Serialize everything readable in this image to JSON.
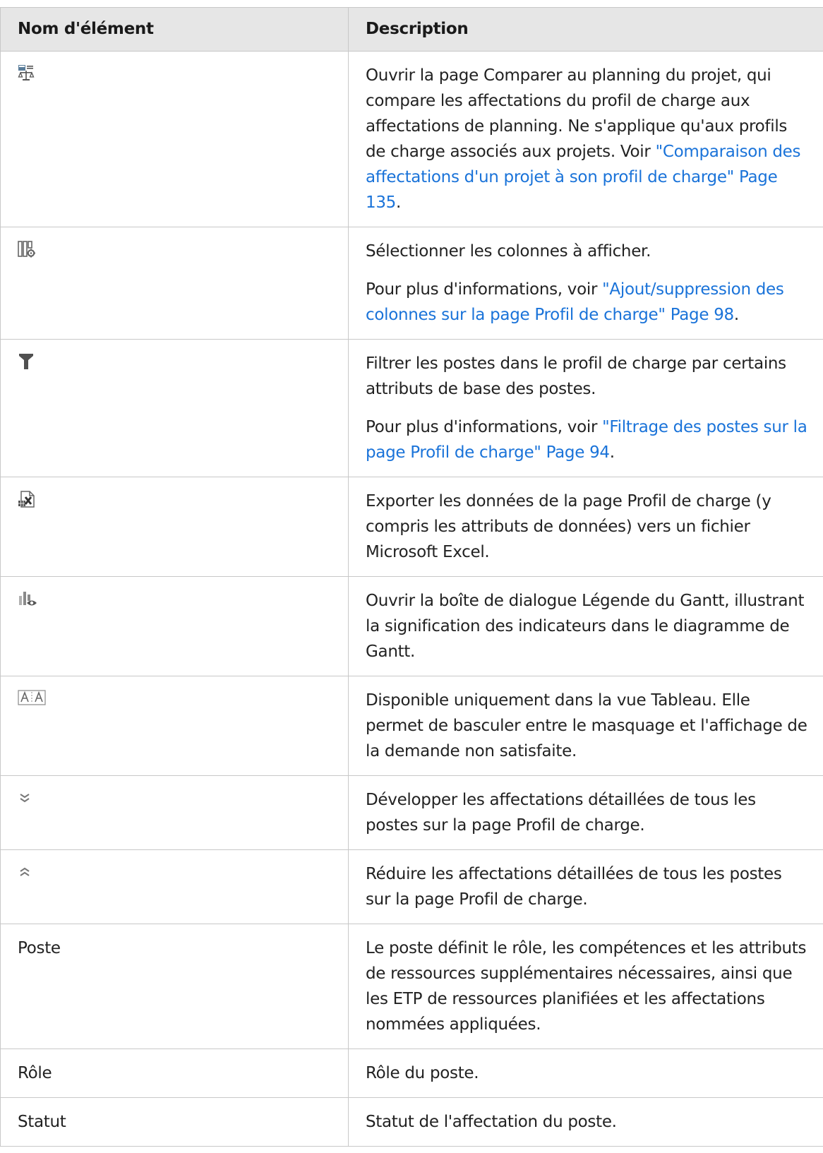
{
  "table": {
    "headers": {
      "name": "Nom d'élément",
      "description": "Description"
    },
    "rows": [
      {
        "icon": "compare-schedule-icon",
        "description": [
          {
            "text": "Ouvrir la page Comparer au planning du projet, qui compare les affectations du profil de charge aux affectations de planning. Ne s'applique qu'aux profils de charge associés aux projets. Voir ",
            "link": "\"Comparaison des affectations d'un projet à son profil de charge\" Page 135",
            "after": "."
          }
        ]
      },
      {
        "icon": "column-settings-icon",
        "description": [
          {
            "text": "Sélectionner les colonnes à afficher."
          },
          {
            "text": "Pour plus d'informations, voir ",
            "link": "\"Ajout/suppression des colonnes sur la page Profil de charge\" Page 98",
            "after": "."
          }
        ]
      },
      {
        "icon": "filter-icon",
        "description": [
          {
            "text": "Filtrer les postes dans le profil de charge par certains attributs de base des postes."
          },
          {
            "text": "Pour plus d'informations, voir ",
            "link": "\"Filtrage des postes sur la page Profil de charge\" Page 94",
            "after": "."
          }
        ]
      },
      {
        "icon": "excel-export-icon",
        "description": [
          {
            "text": "Exporter les données de la page Profil de charge (y compris les attributs de données) vers un fichier Microsoft Excel."
          }
        ]
      },
      {
        "icon": "gantt-legend-icon",
        "description": [
          {
            "text": "Ouvrir la boîte de dialogue Légende du Gantt, illustrant la signification des indicateurs dans le diagramme de Gantt."
          }
        ]
      },
      {
        "icon": "toggle-unmet-demand-icon",
        "description": [
          {
            "text": "Disponible uniquement dans la vue Tableau. Elle permet de basculer entre le masquage et l'affichage de la demande non satisfaite."
          }
        ]
      },
      {
        "icon": "expand-all-icon",
        "description": [
          {
            "text": "Développer les affectations détaillées de tous les postes sur la page Profil de charge."
          }
        ]
      },
      {
        "icon": "collapse-all-icon",
        "description": [
          {
            "text": "Réduire les affectations détaillées de tous les postes sur la page Profil de charge."
          }
        ]
      },
      {
        "name": "Poste",
        "description": [
          {
            "text": "Le poste définit le rôle, les compétences et les attributs de ressources supplémentaires nécessaires, ainsi que les ETP de ressources planifiées et les affectations nommées appliquées."
          }
        ]
      },
      {
        "name": "Rôle",
        "description": [
          {
            "text": "Rôle du poste."
          }
        ]
      },
      {
        "name": "Statut",
        "description": [
          {
            "text": "Statut de l'affectation du poste."
          }
        ]
      }
    ]
  },
  "colors": {
    "link": "#1a73d9",
    "header_bg": "#e6e6e6",
    "border": "#c8c8c8"
  }
}
